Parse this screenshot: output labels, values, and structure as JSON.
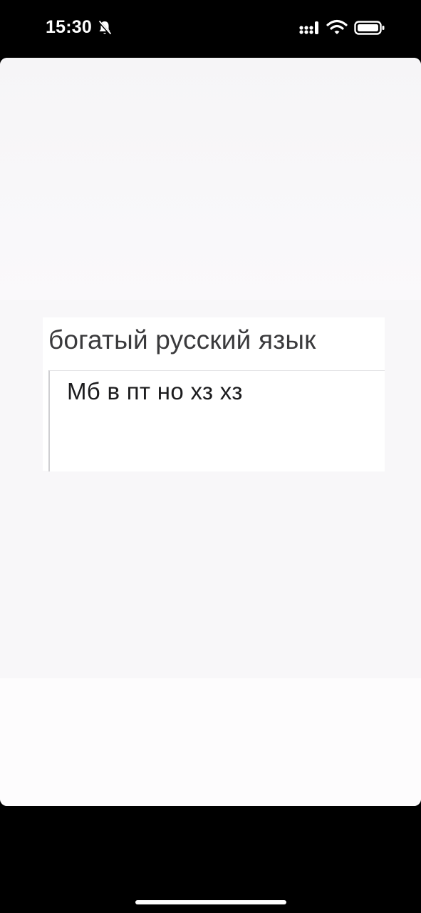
{
  "status_bar": {
    "time": "15:30",
    "icons": [
      "bell-muted-icon",
      "signal-icon",
      "wifi-icon",
      "battery-icon"
    ]
  },
  "photo": {
    "heading": "богатый русский язык",
    "answer": "Мб в пт но хз хз"
  },
  "colors": {
    "background": "#000000",
    "photo_background": "#f8f7f9",
    "heading_text": "#3a3a3c",
    "answer_text": "#1c1c1e"
  }
}
